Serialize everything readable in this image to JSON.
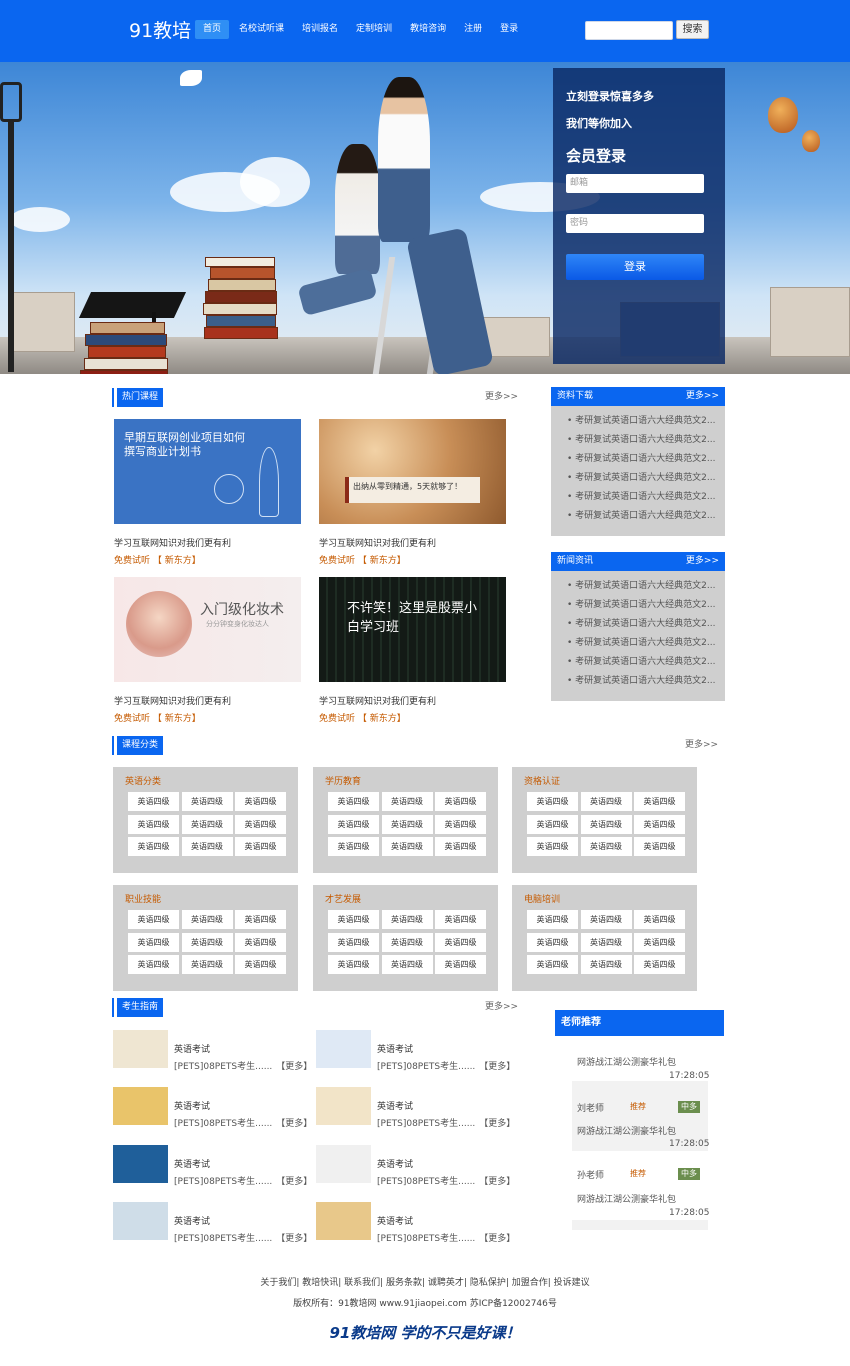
{
  "header": {
    "logo": "91教培",
    "nav": [
      "首页",
      "名校试听课",
      "培训报名",
      "定制培训",
      "教培咨询",
      "注册",
      "登录"
    ],
    "search_button": "搜索"
  },
  "login": {
    "line1": "立刻登录惊喜多多",
    "line2": "我们等你加入",
    "title": "会员登录",
    "email_placeholder": "邮箱",
    "password_placeholder": "密码",
    "button": "登录"
  },
  "hot": {
    "title": "热门课程",
    "more": "更多>>",
    "items": [
      {
        "img_title": "早期互联网创业项目如何撰写商业计划书",
        "caption": "学习互联网知识对我们更有利",
        "free": "免费试听",
        "org": "【 新东方】"
      },
      {
        "img_title": "出纳从零到精通，5天就够了！",
        "caption": "学习互联网知识对我们更有利",
        "free": "免费试听",
        "org": "【 新东方】"
      },
      {
        "img_title": "入门级化妆术",
        "img_sub": "分分钟变身化妆达人",
        "caption": "学习互联网知识对我们更有利",
        "free": "免费试听",
        "org": "【 新东方】"
      },
      {
        "img_title": "不许笑！这里是股票小白学习班",
        "caption": "学习互联网知识对我们更有利",
        "free": "免费试听",
        "org": "【 新东方】"
      }
    ]
  },
  "downloads": {
    "title": "资料下载",
    "more": "更多>>",
    "items": [
      "考研复试英语口语六大经典范文2...",
      "考研复试英语口语六大经典范文2...",
      "考研复试英语口语六大经典范文2...",
      "考研复试英语口语六大经典范文2...",
      "考研复试英语口语六大经典范文2...",
      "考研复试英语口语六大经典范文2..."
    ]
  },
  "news": {
    "title": "新闻资讯",
    "more": "更多>>",
    "items": [
      "考研复试英语口语六大经典范文2...",
      "考研复试英语口语六大经典范文2...",
      "考研复试英语口语六大经典范文2...",
      "考研复试英语口语六大经典范文2...",
      "考研复试英语口语六大经典范文2...",
      "考研复试英语口语六大经典范文2..."
    ]
  },
  "categories": {
    "title": "课程分类",
    "more": "更多>>",
    "cell": "英语四级",
    "groups": [
      "英语分类",
      "学历教育",
      "资格认证",
      "职业技能",
      "才艺发展",
      "电脑培训"
    ]
  },
  "guide": {
    "title": "考生指南",
    "more": "更多>>",
    "items": [
      {
        "t1": "英语考试",
        "t2": "[PETS]08PETS考生......",
        "m": "【更多】"
      },
      {
        "t1": "英语考试",
        "t2": "[PETS]08PETS考生......",
        "m": "【更多】"
      },
      {
        "t1": "英语考试",
        "t2": "[PETS]08PETS考生......",
        "m": "【更多】"
      },
      {
        "t1": "英语考试",
        "t2": "[PETS]08PETS考生......",
        "m": "【更多】"
      },
      {
        "t1": "英语考试",
        "t2": "[PETS]08PETS考生......",
        "m": "【更多】"
      },
      {
        "t1": "英语考试",
        "t2": "[PETS]08PETS考生......",
        "m": "【更多】"
      },
      {
        "t1": "英语考试",
        "t2": "[PETS]08PETS考生......",
        "m": "【更多】"
      },
      {
        "t1": "英语考试",
        "t2": "[PETS]08PETS考生......",
        "m": "【更多】"
      }
    ]
  },
  "teachers": {
    "title": "老师推荐",
    "line": "网游战江湖公测豪华礼包",
    "time": "17:28:05",
    "t1": "刘老师",
    "t2": "孙老师",
    "rec": "推荐",
    "tag": "中多"
  },
  "footer": {
    "links": "关于我们| 教培快讯| 联系我们| 服务条款| 诚聘英才| 隐私保护| 加盟合作| 投诉建议",
    "copy": "版权所有：91教培网 www.91jiaopei.com 苏ICP备12002746号",
    "slogan": "91教培网  学的不只是好课！"
  }
}
